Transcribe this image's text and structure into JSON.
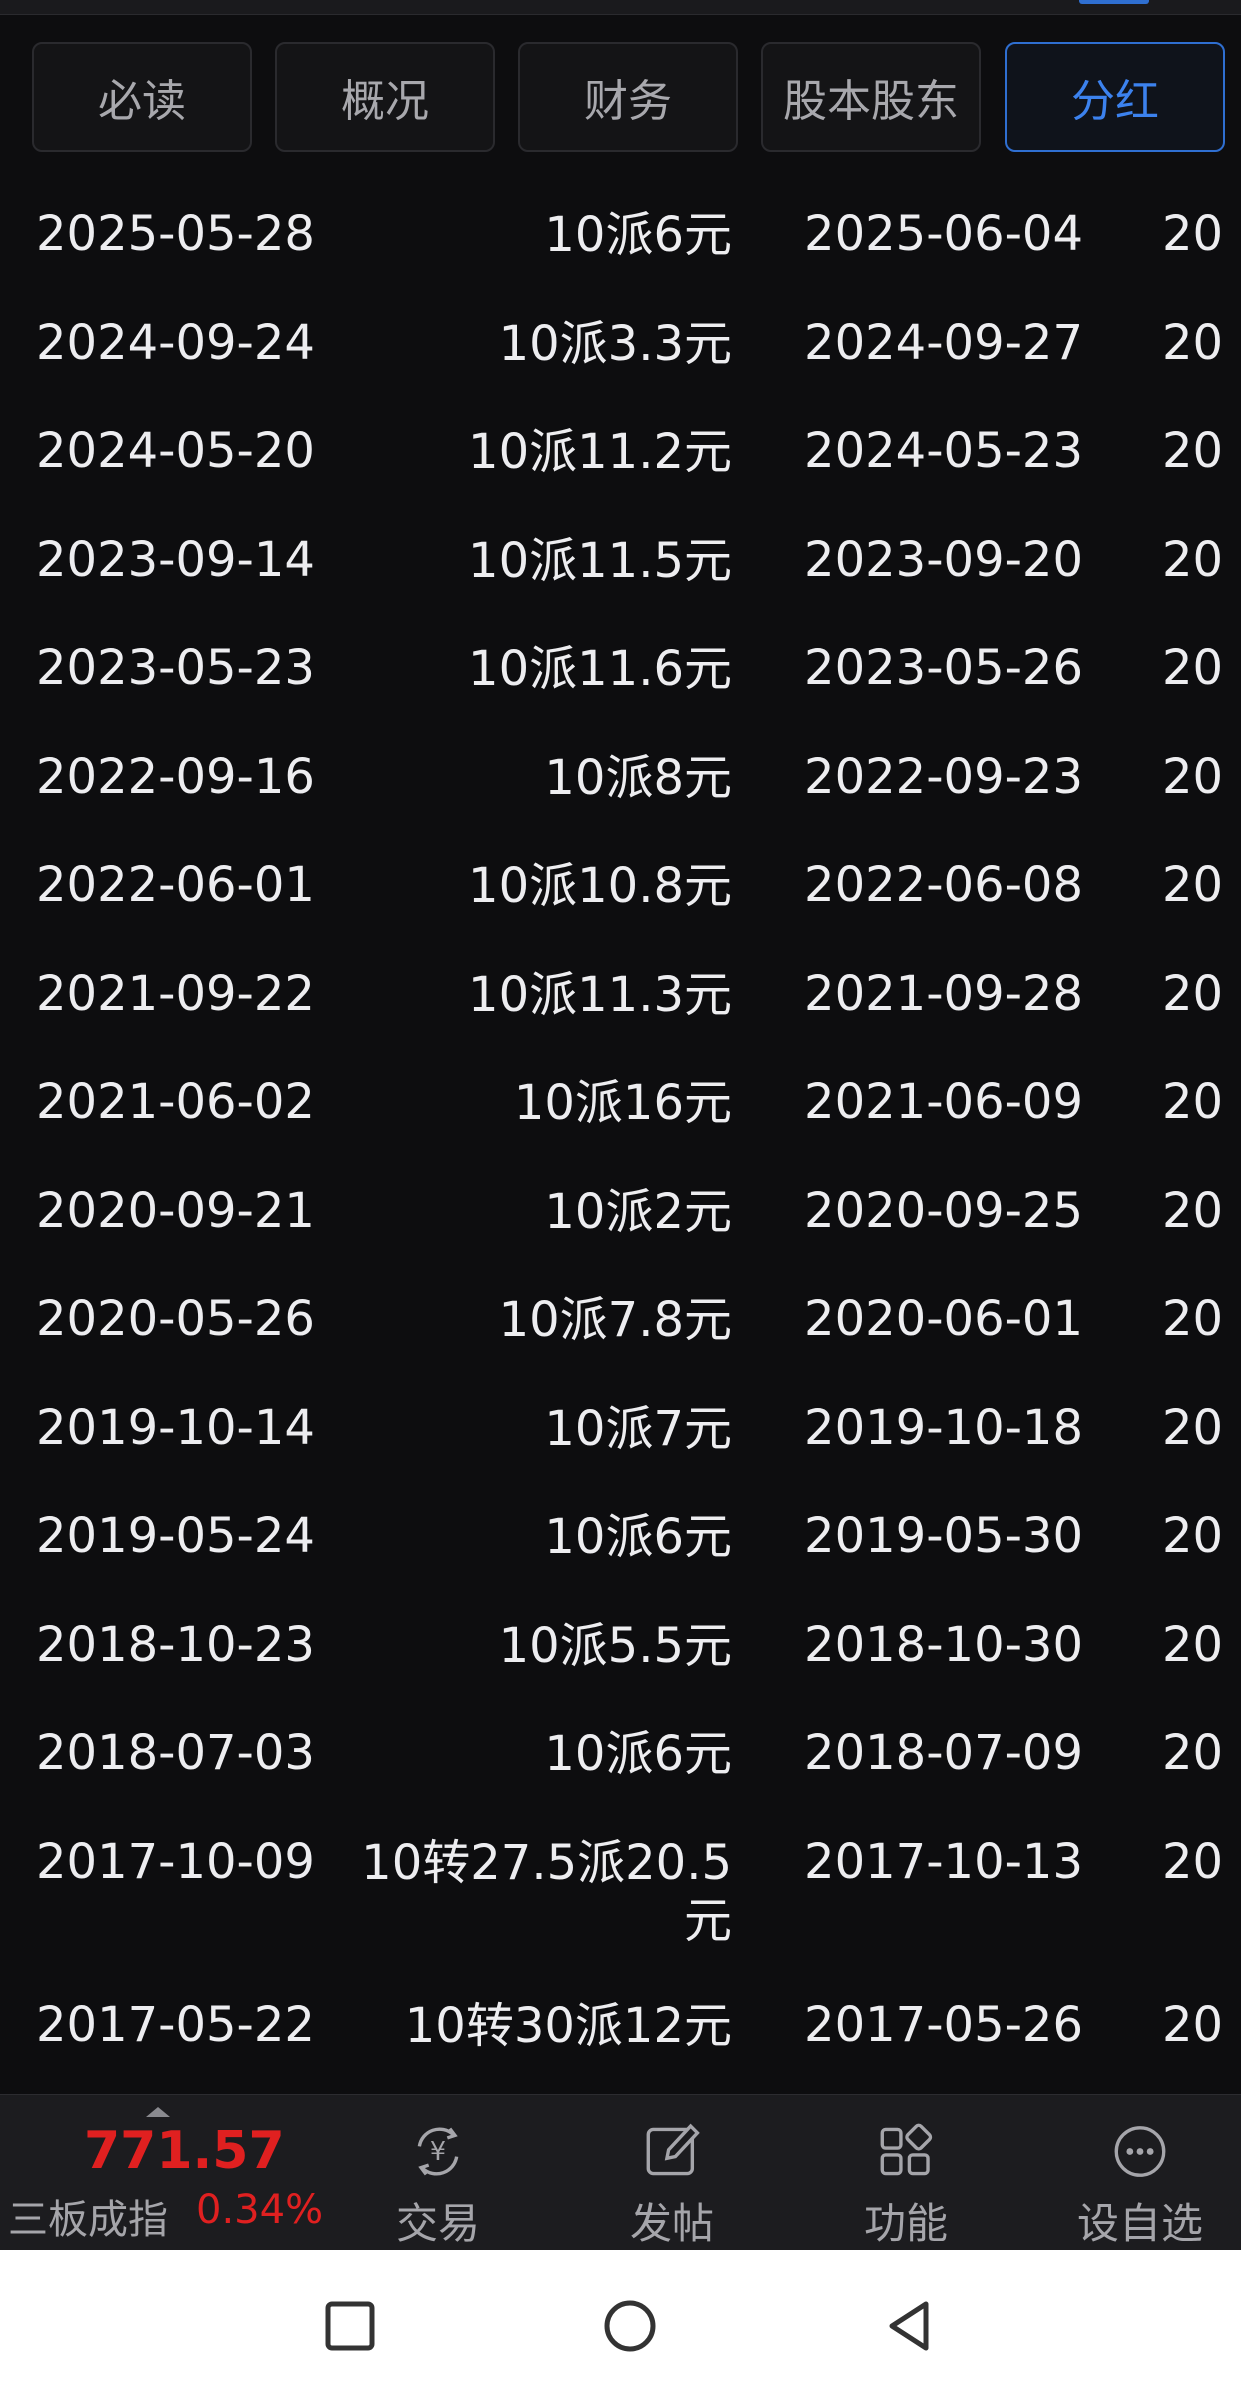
{
  "tabs": [
    {
      "label": "必读",
      "active": false
    },
    {
      "label": "概况",
      "active": false
    },
    {
      "label": "财务",
      "active": false
    },
    {
      "label": "股本股东",
      "active": false
    },
    {
      "label": "分红",
      "active": true
    }
  ],
  "dividends": [
    {
      "announce_date": "2025-05-28",
      "plan": "10派6元",
      "ex_date": "2025-06-04",
      "cut": "20"
    },
    {
      "announce_date": "2024-09-24",
      "plan": "10派3.3元",
      "ex_date": "2024-09-27",
      "cut": "20"
    },
    {
      "announce_date": "2024-05-20",
      "plan": "10派11.2元",
      "ex_date": "2024-05-23",
      "cut": "20"
    },
    {
      "announce_date": "2023-09-14",
      "plan": "10派11.5元",
      "ex_date": "2023-09-20",
      "cut": "20"
    },
    {
      "announce_date": "2023-05-23",
      "plan": "10派11.6元",
      "ex_date": "2023-05-26",
      "cut": "20"
    },
    {
      "announce_date": "2022-09-16",
      "plan": "10派8元",
      "ex_date": "2022-09-23",
      "cut": "20"
    },
    {
      "announce_date": "2022-06-01",
      "plan": "10派10.8元",
      "ex_date": "2022-06-08",
      "cut": "20"
    },
    {
      "announce_date": "2021-09-22",
      "plan": "10派11.3元",
      "ex_date": "2021-09-28",
      "cut": "20"
    },
    {
      "announce_date": "2021-06-02",
      "plan": "10派16元",
      "ex_date": "2021-06-09",
      "cut": "20"
    },
    {
      "announce_date": "2020-09-21",
      "plan": "10派2元",
      "ex_date": "2020-09-25",
      "cut": "20"
    },
    {
      "announce_date": "2020-05-26",
      "plan": "10派7.8元",
      "ex_date": "2020-06-01",
      "cut": "20"
    },
    {
      "announce_date": "2019-10-14",
      "plan": "10派7元",
      "ex_date": "2019-10-18",
      "cut": "20"
    },
    {
      "announce_date": "2019-05-24",
      "plan": "10派6元",
      "ex_date": "2019-05-30",
      "cut": "20"
    },
    {
      "announce_date": "2018-10-23",
      "plan": "10派5.5元",
      "ex_date": "2018-10-30",
      "cut": "20"
    },
    {
      "announce_date": "2018-07-03",
      "plan": "10派6元",
      "ex_date": "2018-07-09",
      "cut": "20"
    },
    {
      "announce_date": "2017-10-09",
      "plan": "10转27.5派20.5元",
      "ex_date": "2017-10-13",
      "cut": "20"
    },
    {
      "announce_date": "2017-05-22",
      "plan": "10转30派12元",
      "ex_date": "2017-05-26",
      "cut": "20"
    }
  ],
  "index_ticker": {
    "value": "771.57",
    "name": "三板成指",
    "change": "0.34%"
  },
  "bottom_nav": [
    {
      "label": "交易",
      "icon": "trade-yen-icon"
    },
    {
      "label": "发帖",
      "icon": "compose-icon"
    },
    {
      "label": "功能",
      "icon": "apps-grid-icon"
    },
    {
      "label": "设自选",
      "icon": "more-circle-icon"
    }
  ],
  "colors": {
    "accent": "#3c82ee",
    "up": "#e02020",
    "background": "#0d0d0f"
  }
}
